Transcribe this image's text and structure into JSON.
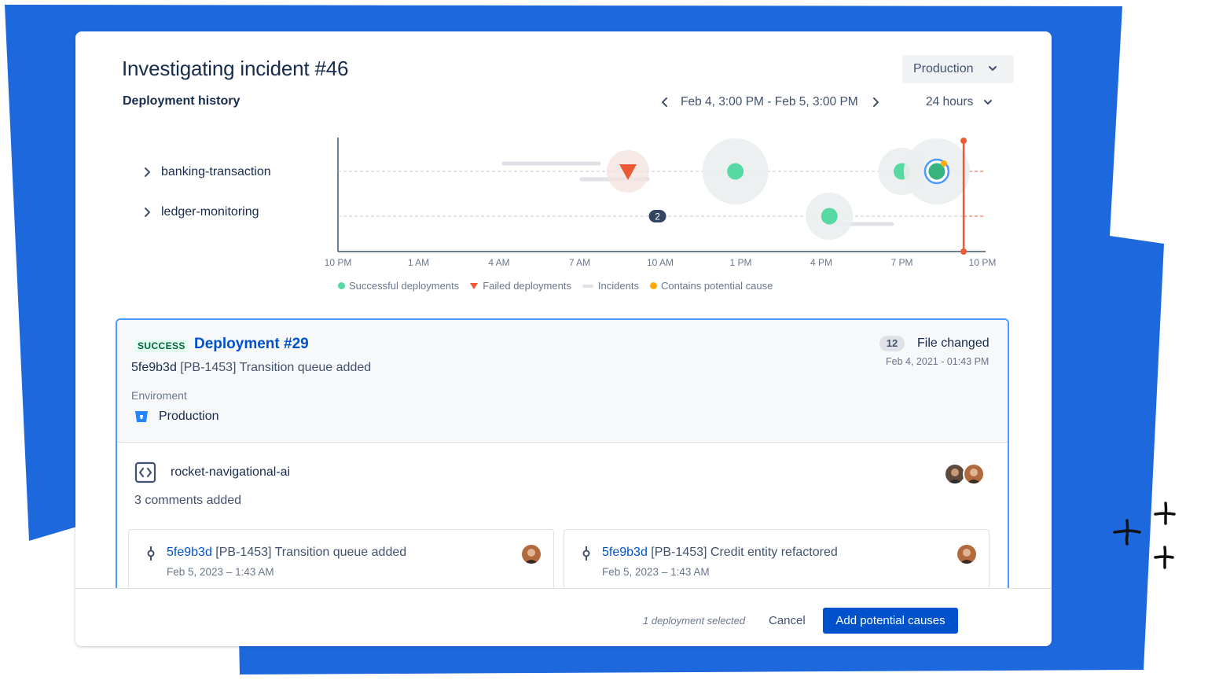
{
  "colors": {
    "brand_blue": "#1E68DE",
    "primary": "#0052CC",
    "success": "#57D9A3",
    "failed": "#EB5A34",
    "potential_cause": "#FFAB00",
    "incident": "#DFE1E6"
  },
  "header": {
    "title": "Investigating incident #46",
    "subtitle": "Deployment history",
    "environment_dropdown": {
      "value": "Production",
      "icon": "chevron-down-icon"
    },
    "range": {
      "label": "Feb 4, 3:00 PM - Feb 5, 3:00 PM",
      "prev_icon": "chevron-left-icon",
      "next_icon": "chevron-right-icon"
    },
    "span_select": {
      "value": "24 hours",
      "icon": "chevron-down-icon"
    }
  },
  "services": [
    {
      "label": "banking-transaction",
      "icon": "chevron-right-icon"
    },
    {
      "label": "ledger-monitoring",
      "icon": "chevron-right-icon"
    }
  ],
  "chart_data": {
    "type": "scatter",
    "x_ticks": [
      "10 PM",
      "1 AM",
      "4 AM",
      "7 AM",
      "10 AM",
      "1 PM",
      "4 PM",
      "7 PM",
      "10 PM"
    ],
    "rows": [
      "banking-transaction",
      "ledger-monitoring"
    ],
    "xlim": [
      0,
      24
    ],
    "now_marker_x": 23.3,
    "successful": [
      {
        "row": 0,
        "x": 14.8,
        "halo": "large"
      },
      {
        "row": 0,
        "x": 21.0,
        "halo": "medium"
      },
      {
        "row": 0,
        "x": 22.3,
        "halo": "large",
        "selected": true,
        "potential_cause": true
      },
      {
        "row": 1,
        "x": 18.3,
        "halo": "medium"
      }
    ],
    "failed": [
      {
        "row": 0,
        "x": 10.8
      }
    ],
    "clusters": [
      {
        "row": 1,
        "x": 11.9,
        "count": "2"
      }
    ],
    "incidents": [
      {
        "row": 0,
        "start": 6.1,
        "end": 9.8,
        "offset": "above"
      },
      {
        "row": 0,
        "start": 9.0,
        "end": 11.6,
        "offset": "below"
      },
      {
        "row": 1,
        "start": 18.3,
        "end": 20.7,
        "offset": "below"
      }
    ],
    "legend": [
      {
        "label": "Successful deployments",
        "marker": "dot",
        "color": "#57D9A3"
      },
      {
        "label": "Failed deployments",
        "marker": "triangle",
        "color": "#EB5A34"
      },
      {
        "label": "Incidents",
        "marker": "bar",
        "color": "#DFE1E6"
      },
      {
        "label": "Contains potential cause",
        "marker": "dot",
        "color": "#FFAB00"
      }
    ]
  },
  "deployment": {
    "status": "SUCCESS",
    "title": "Deployment #29",
    "commit_hash": "5fe9b3d",
    "commit_message": "[PB-1453] Transition queue added",
    "env_label": "Enviroment",
    "env_value": "Production",
    "files_count": "12",
    "files_label": "File changed",
    "files_date": "Feb 4, 2021 - 01:43 PM"
  },
  "repo": {
    "name": "rocket-navigational-ai",
    "comments": "3 comments added",
    "commits": [
      {
        "hash": "5fe9b3d",
        "message": "[PB-1453] Transition queue added",
        "date": "Feb 5, 2023 – 1:43 AM"
      },
      {
        "hash": "5fe9b3d",
        "message": "[PB-1453] Credit entity refactored",
        "date": "Feb 5, 2023 – 1:43 AM"
      }
    ]
  },
  "footer": {
    "selected_note": "1 deployment selected",
    "cancel_label": "Cancel",
    "primary_label": "Add potential causes"
  }
}
